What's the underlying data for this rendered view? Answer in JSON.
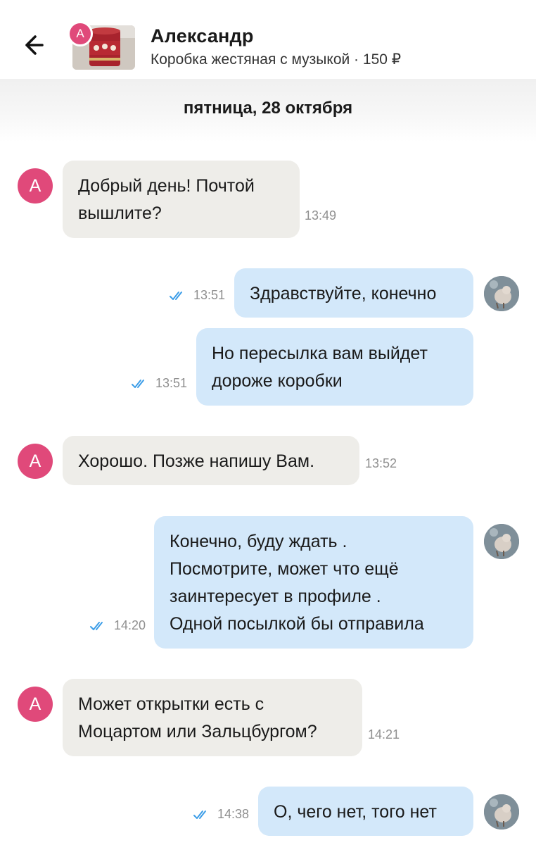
{
  "header": {
    "back_icon": "arrow-left-icon",
    "contact_name": "Александр",
    "contact_initial": "А",
    "product_line": "Коробка жестяная с музыкой · 150 ₽"
  },
  "date_divider": "пятница, 28 октября",
  "messages": [
    {
      "direction": "in",
      "avatar": "А",
      "text": "Добрый день! Почтой\nвышлите?",
      "time": "13:49"
    },
    {
      "direction": "out",
      "text": "Здравствуйте, конечно",
      "time": "13:51",
      "status": "read"
    },
    {
      "direction": "out",
      "text": "Но пересылка вам выйдет\nдороже коробки",
      "time": "13:51",
      "status": "read"
    },
    {
      "direction": "in",
      "avatar": "А",
      "text": "Хорошо. Позже напишу Вам.",
      "time": "13:52"
    },
    {
      "direction": "out",
      "text": "Конечно, буду ждать .\nПосмотрите, может что ещё\nзаинтересует в профиле .\nОдной посылкой бы отправила",
      "time": "14:20",
      "status": "read"
    },
    {
      "direction": "in",
      "avatar": "А",
      "text": "Может открытки есть с\nМоцартом или Зальцбургом?",
      "time": "14:21"
    },
    {
      "direction": "out",
      "text": "О, чего нет, того нет",
      "time": "14:38",
      "status": "read"
    }
  ],
  "colors": {
    "incoming_bubble": "#eeede9",
    "outgoing_bubble": "#d3e8fa",
    "avatar_accent": "#e0497a",
    "read_check": "#3d9ee8"
  }
}
